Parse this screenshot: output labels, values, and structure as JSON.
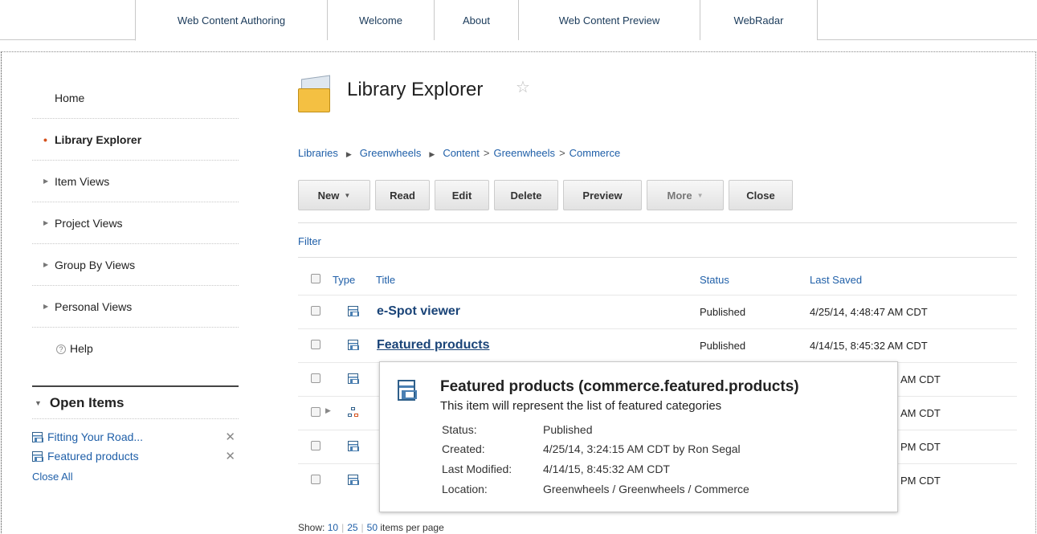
{
  "tabs": [
    {
      "label": "Web Content Authoring",
      "active": true
    },
    {
      "label": "Welcome"
    },
    {
      "label": "About"
    },
    {
      "label": "Web Content Preview"
    },
    {
      "label": "WebRadar"
    }
  ],
  "sidebar": {
    "items": [
      {
        "label": "Home"
      },
      {
        "label": "Library Explorer"
      },
      {
        "label": "Item Views"
      },
      {
        "label": "Project Views"
      },
      {
        "label": "Group By Views"
      },
      {
        "label": "Personal Views"
      },
      {
        "label": "Help"
      }
    ]
  },
  "open_items": {
    "heading": "Open Items",
    "items": [
      {
        "label": "Fitting Your Road..."
      },
      {
        "label": "Featured products"
      }
    ],
    "close_all": "Close All"
  },
  "main": {
    "title": "Library Explorer",
    "breadcrumb": {
      "libraries": "Libraries",
      "library": "Greenwheels",
      "content": "Content",
      "gt1": ">",
      "site": "Greenwheels",
      "gt2": ">",
      "area": "Commerce"
    },
    "toolbar": {
      "new": "New",
      "read": "Read",
      "edit": "Edit",
      "delete": "Delete",
      "preview": "Preview",
      "more": "More",
      "close": "Close"
    },
    "filter": "Filter",
    "table": {
      "headers": {
        "type": "Type",
        "title": "Title",
        "status": "Status",
        "last_saved": "Last Saved"
      },
      "rows": [
        {
          "title": "e-Spot viewer",
          "status": "Published",
          "last_saved": "4/25/14, 4:48:47 AM CDT"
        },
        {
          "title": "Featured products",
          "status": "Published",
          "last_saved": "4/14/15, 8:45:32 AM CDT"
        },
        {
          "title": "",
          "status": "",
          "last_saved": "AM CDT"
        },
        {
          "title": "",
          "status": "",
          "last_saved": "AM CDT"
        },
        {
          "title": "",
          "status": "",
          "last_saved": "PM CDT"
        },
        {
          "title": "",
          "status": "",
          "last_saved": "PM CDT"
        }
      ]
    },
    "pager": {
      "show": "Show:",
      "opt1": "10",
      "opt2": "25",
      "opt3": "50",
      "suffix": "items per page"
    }
  },
  "tooltip": {
    "title": "Featured products (commerce.featured.products)",
    "description": "This item will represent the list of featured categories",
    "status_label": "Status:",
    "status": "Published",
    "created_label": "Created:",
    "created": "4/25/14, 3:24:15 AM CDT by Ron Segal",
    "modified_label": "Last Modified:",
    "modified": "4/14/15, 8:45:32 AM CDT",
    "location_label": "Location:",
    "location": "Greenwheels / Greenwheels / Commerce"
  }
}
